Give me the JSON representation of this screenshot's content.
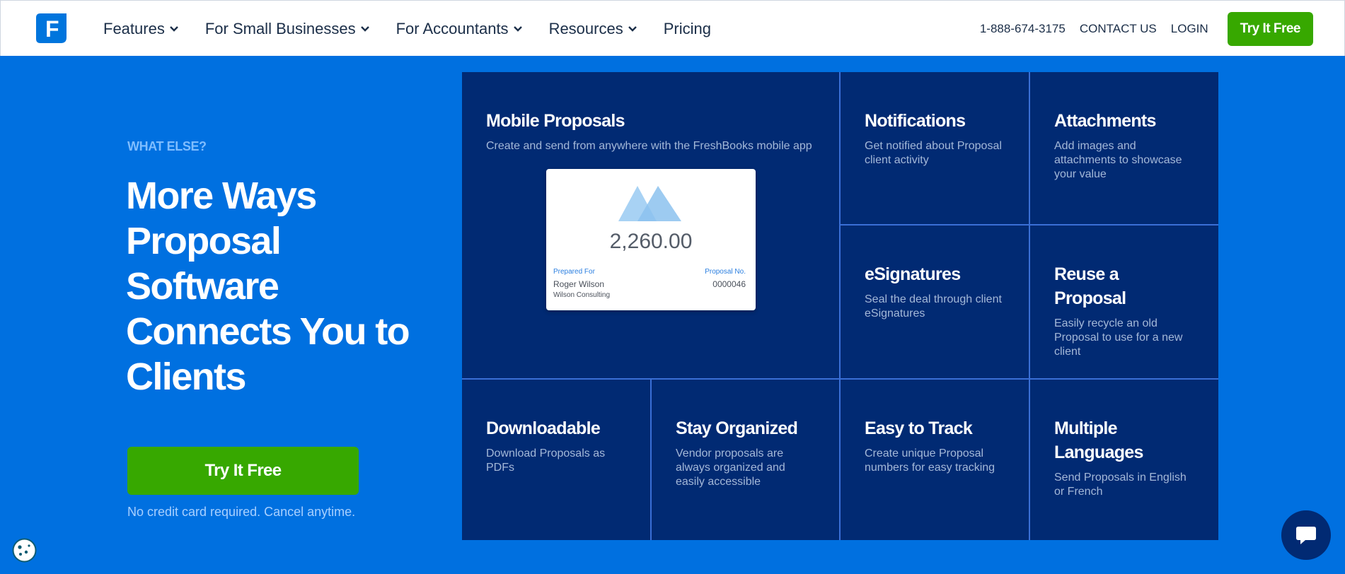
{
  "header": {
    "logo_letter": "F",
    "nav": [
      {
        "label": "Features",
        "has_dropdown": true
      },
      {
        "label": "For Small Businesses",
        "has_dropdown": true
      },
      {
        "label": "For Accountants",
        "has_dropdown": true
      },
      {
        "label": "Resources",
        "has_dropdown": true
      },
      {
        "label": "Pricing",
        "has_dropdown": false
      }
    ],
    "phone": "1-888-674-3175",
    "contact": "CONTACT US",
    "login": "LOGIN",
    "cta": "Try It Free"
  },
  "hero": {
    "eyebrow": "WHAT ELSE?",
    "title": "More Ways Proposal Software Connects You to Clients",
    "cta": "Try It Free",
    "note": "No credit card required. Cancel anytime."
  },
  "features": {
    "mobile": {
      "title": "Mobile Proposals",
      "desc": "Create and send from anywhere with the FreshBooks mobile app"
    },
    "notifications": {
      "title": "Notifications",
      "desc": "Get notified about Proposal client activity"
    },
    "attachments": {
      "title": "Attachments",
      "desc": "Add images and attachments to showcase your value"
    },
    "esignatures": {
      "title": "eSignatures",
      "desc": "Seal the deal through client eSignatures"
    },
    "reuse": {
      "title": "Reuse a Proposal",
      "desc": "Easily recycle an old Proposal to use for a new client"
    },
    "downloadable": {
      "title": "Downloadable",
      "desc": "Download Proposals as PDFs"
    },
    "organized": {
      "title": "Stay Organized",
      "desc": "Vendor proposals are always organized and easily accessible"
    },
    "track": {
      "title": "Easy to Track",
      "desc": "Create unique Proposal numbers for easy tracking"
    },
    "languages": {
      "title": "Multiple Languages",
      "desc": "Send Proposals in English or French"
    }
  },
  "proposal_card": {
    "amount": "2,260.00",
    "prepared_for_label": "Prepared For",
    "proposal_no_label": "Proposal No.",
    "client": "Roger Wilson",
    "company": "Wilson Consulting",
    "number": "0000046"
  },
  "colors": {
    "brand_blue": "#0070e0",
    "navy": "#012a73",
    "green": "#37a800"
  },
  "icons": [
    "freshbooks-logo-icon",
    "chevron-down-icon",
    "cookie-icon",
    "chat-bubble-icon"
  ]
}
